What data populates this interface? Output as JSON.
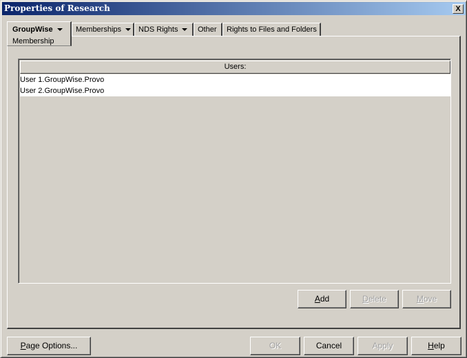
{
  "window": {
    "title": "Properties of Research",
    "close_label": "X"
  },
  "tabs": [
    {
      "label": "GroupWise",
      "sub_label": "Membership",
      "has_dropdown": true,
      "active": true
    },
    {
      "label": "Memberships",
      "has_dropdown": true
    },
    {
      "label": "NDS Rights",
      "has_dropdown": true
    },
    {
      "label": "Other",
      "has_dropdown": false
    },
    {
      "label": "Rights to Files and Folders",
      "has_dropdown": false
    }
  ],
  "users_list": {
    "header": "Users:",
    "items": [
      "User 1.GroupWise.Provo",
      "User 2.GroupWise.Provo"
    ]
  },
  "list_buttons": {
    "add": {
      "mnemonic": "A",
      "rest": "dd",
      "enabled": true
    },
    "delete": {
      "mnemonic": "D",
      "rest": "elete",
      "enabled": false
    },
    "move": {
      "mnemonic": "M",
      "rest": "ove",
      "enabled": false
    }
  },
  "footer_buttons": {
    "page_options": {
      "mnemonic": "P",
      "rest": "age Options...",
      "enabled": true
    },
    "ok": {
      "label": "OK",
      "enabled": false
    },
    "cancel": {
      "label": "Cancel",
      "enabled": true
    },
    "apply": {
      "label": "Apply",
      "enabled": false
    },
    "help": {
      "mnemonic": "H",
      "rest": "elp",
      "enabled": true
    }
  }
}
